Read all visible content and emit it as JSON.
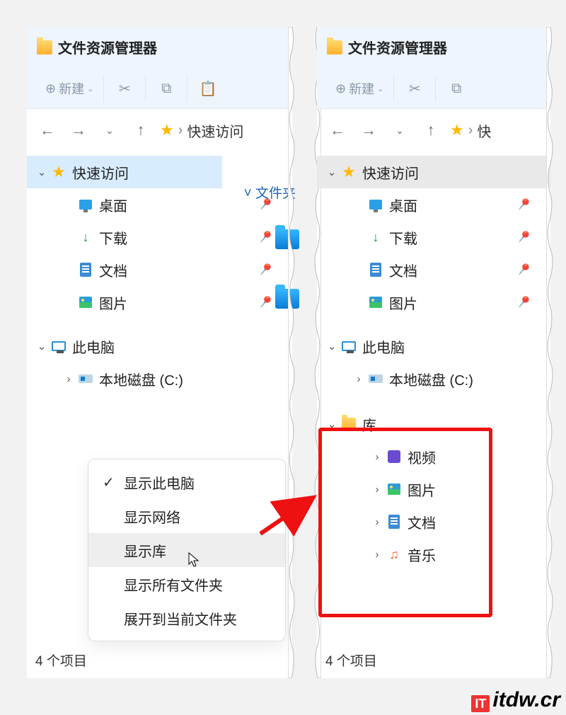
{
  "window_title": "文件资源管理器",
  "toolbar": {
    "new_label": "新建"
  },
  "breadcrumb": {
    "quick_access": "快速访问",
    "quick_short": "快"
  },
  "folders_label": "文件夹",
  "tree": {
    "quick_access": "快速访问",
    "desktop": "桌面",
    "downloads": "下载",
    "documents": "文档",
    "pictures": "图片",
    "this_pc": "此电脑",
    "local_disk": "本地磁盘 (C:)",
    "libraries": "库",
    "videos": "视频",
    "music": "音乐"
  },
  "context_menu": {
    "show_this_pc": "显示此电脑",
    "show_network": "显示网络",
    "show_libraries": "显示库",
    "show_all_folders": "显示所有文件夹",
    "expand_to_current": "展开到当前文件夹"
  },
  "status": {
    "items": "4 个项目"
  },
  "watermark": {
    "tag": "IT",
    "text": "itdw.cr"
  }
}
